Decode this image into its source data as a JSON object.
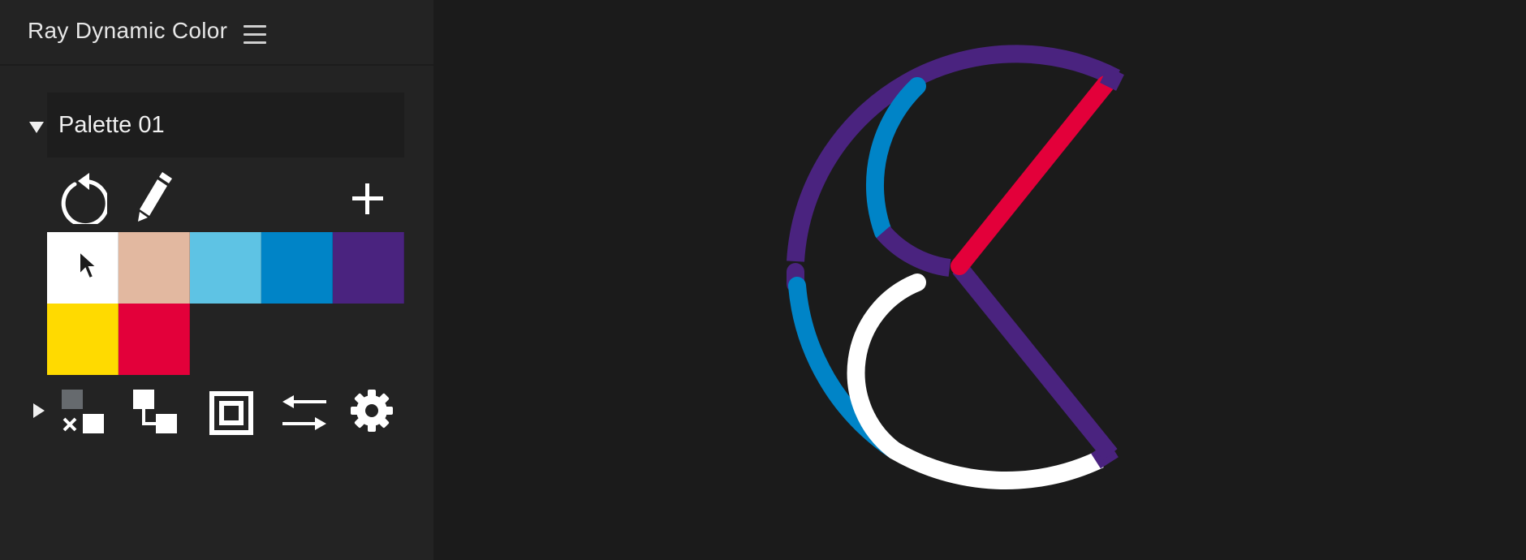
{
  "panel": {
    "title": "Ray Dynamic Color",
    "menu_icon": "hamburger-menu-icon"
  },
  "palette": {
    "name": "Palette 01",
    "expanded": true,
    "tools": {
      "reset_icon": "reset-icon",
      "edit_icon": "pencil-icon",
      "add_icon": "plus-icon"
    },
    "swatches": [
      {
        "color": "#FFFFFF",
        "label": "white"
      },
      {
        "color": "#E2B8A0",
        "label": "peach"
      },
      {
        "color": "#5EC3E4",
        "label": "light-blue"
      },
      {
        "color": "#0084C7",
        "label": "blue"
      },
      {
        "color": "#4A237F",
        "label": "purple"
      },
      {
        "color": "#FFDA00",
        "label": "yellow"
      },
      {
        "color": "#E3003A",
        "label": "red"
      }
    ]
  },
  "bottom_toolbar": {
    "expand_icon": "caret-right-icon",
    "items": [
      "remove-fill-icon",
      "link-objects-icon",
      "stroke-frame-icon",
      "swap-arrows-icon",
      "gear-icon"
    ]
  },
  "canvas": {
    "artwork": "circle-line-logo",
    "colors": {
      "purple": "#4A237F",
      "blue": "#0084C7",
      "red": "#E3003A",
      "white": "#FFFFFF"
    }
  }
}
